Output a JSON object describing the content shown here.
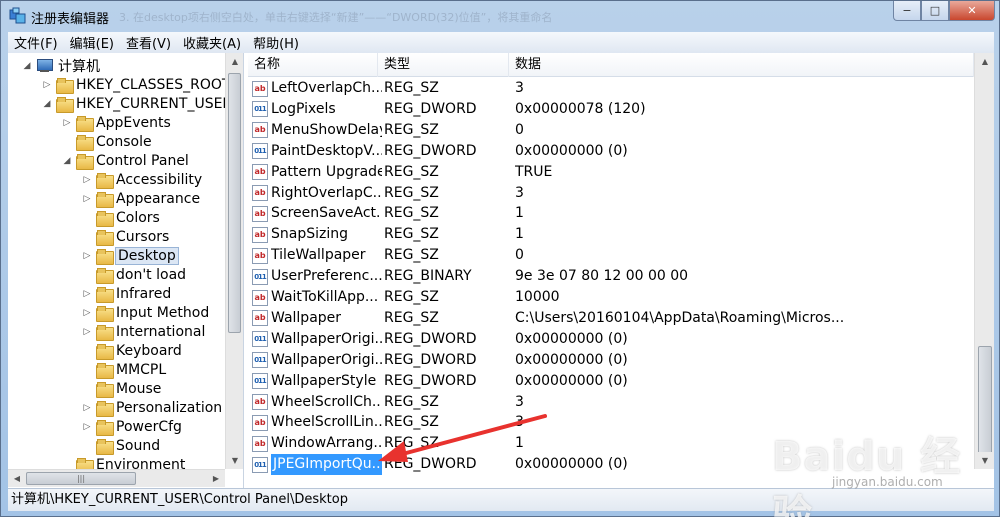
{
  "window": {
    "title": "注册表编辑器",
    "ghost_title": "3. 在desktop项右侧空白处，单击右键选择“新建”——“DWORD(32)位值”，将其重命名",
    "buttons": {
      "minimize": "−",
      "maximize": "□",
      "close": "✕"
    }
  },
  "menu": [
    "文件(F)",
    "编辑(E)",
    "查看(V)",
    "收藏夹(A)",
    "帮助(H)"
  ],
  "tree": [
    {
      "label": "计算机",
      "level": 0,
      "arrow": "◢",
      "icon": "computer-icon"
    },
    {
      "label": "HKEY_CLASSES_ROOT",
      "level": 1,
      "arrow": "▷",
      "icon": "folder-icon"
    },
    {
      "label": "HKEY_CURRENT_USER",
      "level": 1,
      "arrow": "◢",
      "icon": "folder-icon"
    },
    {
      "label": "AppEvents",
      "level": 2,
      "arrow": "▷",
      "icon": "folder-icon"
    },
    {
      "label": "Console",
      "level": 2,
      "arrow": "",
      "icon": "folder-icon"
    },
    {
      "label": "Control Panel",
      "level": 2,
      "arrow": "◢",
      "icon": "folder-icon"
    },
    {
      "label": "Accessibility",
      "level": 3,
      "arrow": "▷",
      "icon": "folder-icon"
    },
    {
      "label": "Appearance",
      "level": 3,
      "arrow": "▷",
      "icon": "folder-icon"
    },
    {
      "label": "Colors",
      "level": 3,
      "arrow": "",
      "icon": "folder-icon"
    },
    {
      "label": "Cursors",
      "level": 3,
      "arrow": "",
      "icon": "folder-icon"
    },
    {
      "label": "Desktop",
      "level": 3,
      "arrow": "▷",
      "icon": "folder-icon",
      "selected": true
    },
    {
      "label": "don't load",
      "level": 3,
      "arrow": "",
      "icon": "folder-icon"
    },
    {
      "label": "Infrared",
      "level": 3,
      "arrow": "▷",
      "icon": "folder-icon"
    },
    {
      "label": "Input Method",
      "level": 3,
      "arrow": "▷",
      "icon": "folder-icon"
    },
    {
      "label": "International",
      "level": 3,
      "arrow": "▷",
      "icon": "folder-icon"
    },
    {
      "label": "Keyboard",
      "level": 3,
      "arrow": "",
      "icon": "folder-icon"
    },
    {
      "label": "MMCPL",
      "level": 3,
      "arrow": "",
      "icon": "folder-icon"
    },
    {
      "label": "Mouse",
      "level": 3,
      "arrow": "",
      "icon": "folder-icon"
    },
    {
      "label": "Personalization",
      "level": 3,
      "arrow": "▷",
      "icon": "folder-icon"
    },
    {
      "label": "PowerCfg",
      "level": 3,
      "arrow": "▷",
      "icon": "folder-icon"
    },
    {
      "label": "Sound",
      "level": 3,
      "arrow": "",
      "icon": "folder-icon"
    },
    {
      "label": "Environment",
      "level": 2,
      "arrow": "",
      "icon": "folder-icon"
    }
  ],
  "list": {
    "headers": {
      "name": "名称",
      "type": "类型",
      "data": "数据"
    },
    "rows": [
      {
        "name": "LeftOverlapCh...",
        "type": "REG_SZ",
        "data": "3",
        "icon": "string-value-icon"
      },
      {
        "name": "LogPixels",
        "type": "REG_DWORD",
        "data": "0x00000078 (120)",
        "icon": "binary-value-icon"
      },
      {
        "name": "MenuShowDelay",
        "type": "REG_SZ",
        "data": "0",
        "icon": "string-value-icon"
      },
      {
        "name": "PaintDesktopV...",
        "type": "REG_DWORD",
        "data": "0x00000000 (0)",
        "icon": "binary-value-icon"
      },
      {
        "name": "Pattern Upgrade",
        "type": "REG_SZ",
        "data": "TRUE",
        "icon": "string-value-icon"
      },
      {
        "name": "RightOverlapC...",
        "type": "REG_SZ",
        "data": "3",
        "icon": "string-value-icon"
      },
      {
        "name": "ScreenSaveAct...",
        "type": "REG_SZ",
        "data": "1",
        "icon": "string-value-icon"
      },
      {
        "name": "SnapSizing",
        "type": "REG_SZ",
        "data": "1",
        "icon": "string-value-icon"
      },
      {
        "name": "TileWallpaper",
        "type": "REG_SZ",
        "data": "0",
        "icon": "string-value-icon"
      },
      {
        "name": "UserPreferenc...",
        "type": "REG_BINARY",
        "data": "9e 3e 07 80 12 00 00 00",
        "icon": "binary-value-icon"
      },
      {
        "name": "WaitToKillApp...",
        "type": "REG_SZ",
        "data": "10000",
        "icon": "string-value-icon"
      },
      {
        "name": "Wallpaper",
        "type": "REG_SZ",
        "data": "C:\\Users\\20160104\\AppData\\Roaming\\Micros...",
        "icon": "string-value-icon"
      },
      {
        "name": "WallpaperOrigi...",
        "type": "REG_DWORD",
        "data": "0x00000000 (0)",
        "icon": "binary-value-icon"
      },
      {
        "name": "WallpaperOrigi...",
        "type": "REG_DWORD",
        "data": "0x00000000 (0)",
        "icon": "binary-value-icon"
      },
      {
        "name": "WallpaperStyle",
        "type": "REG_DWORD",
        "data": "0x00000000 (0)",
        "icon": "binary-value-icon"
      },
      {
        "name": "WheelScrollCh...",
        "type": "REG_SZ",
        "data": "3",
        "icon": "string-value-icon"
      },
      {
        "name": "WheelScrollLin...",
        "type": "REG_SZ",
        "data": "3",
        "icon": "string-value-icon"
      },
      {
        "name": "WindowArrang...",
        "type": "REG_SZ",
        "data": "1",
        "icon": "string-value-icon"
      },
      {
        "name": "JPEGImportQu...",
        "type": "REG_DWORD",
        "data": "0x00000000 (0)",
        "icon": "binary-value-icon",
        "selected": true
      }
    ]
  },
  "status_bar": "计算机\\HKEY_CURRENT_USER\\Control Panel\\Desktop",
  "annotation": {
    "color": "#e8322e"
  },
  "watermark": {
    "brand": "Baidu 经验",
    "sub": "jingyan.baidu.com"
  }
}
